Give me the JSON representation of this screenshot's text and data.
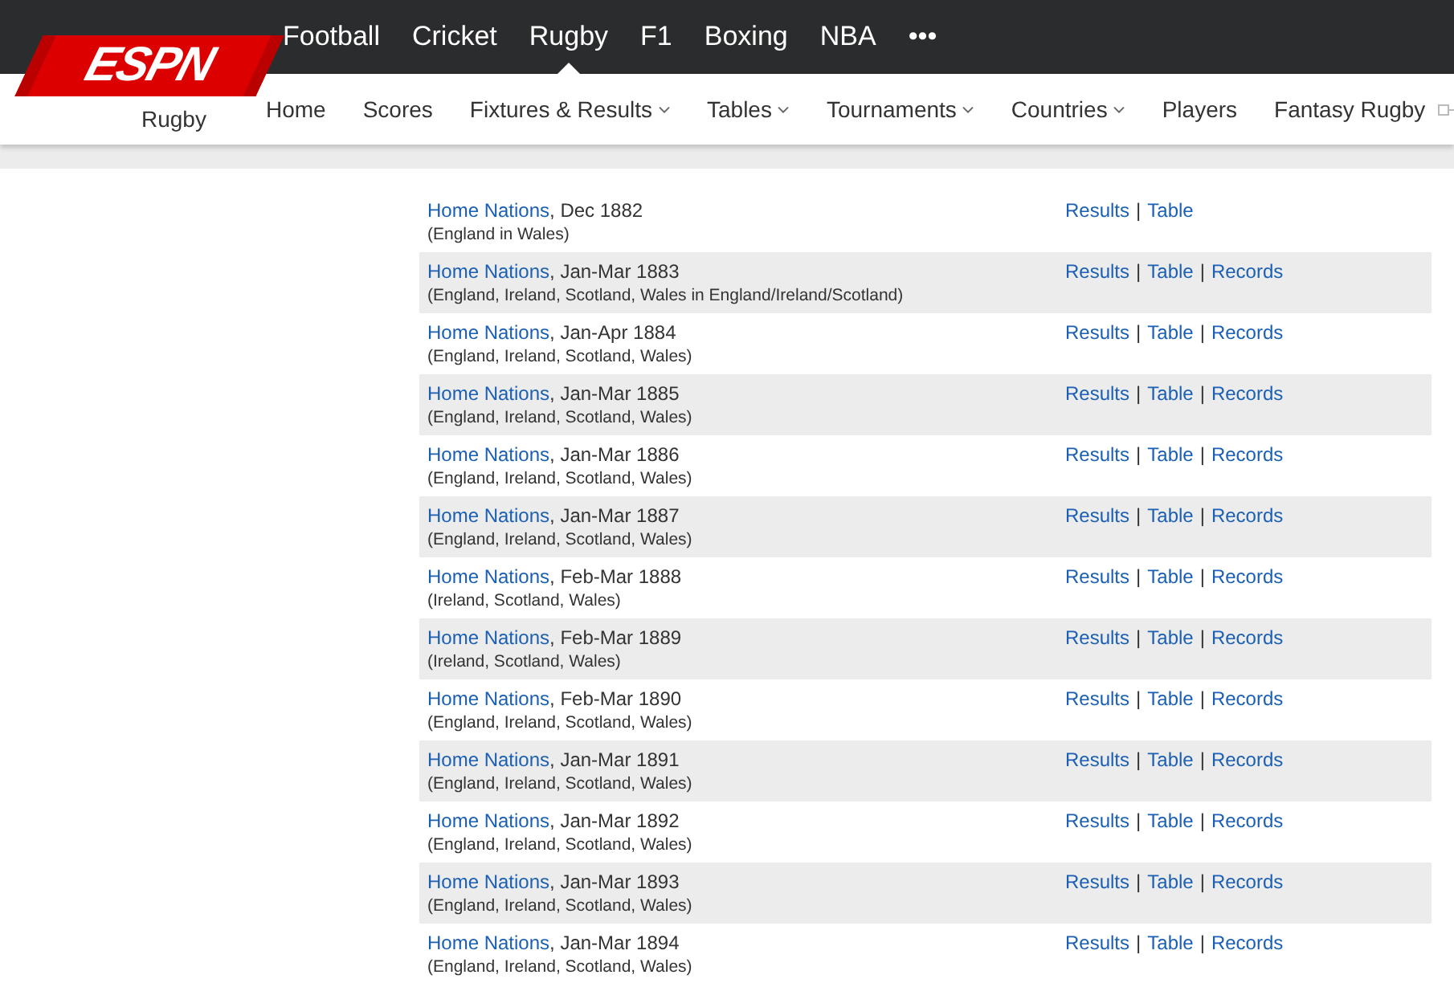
{
  "logo": {
    "text": "ESPN"
  },
  "top_nav": [
    {
      "label": "Football",
      "selected": false
    },
    {
      "label": "Cricket",
      "selected": false
    },
    {
      "label": "Rugby",
      "selected": true
    },
    {
      "label": "F1",
      "selected": false
    },
    {
      "label": "Boxing",
      "selected": false
    },
    {
      "label": "NBA",
      "selected": false
    },
    {
      "label": "•••",
      "selected": false
    }
  ],
  "section_title": "Rugby",
  "sub_nav": [
    {
      "label": "Home",
      "has_menu": false,
      "external": false
    },
    {
      "label": "Scores",
      "has_menu": false,
      "external": false
    },
    {
      "label": "Fixtures & Results",
      "has_menu": true,
      "external": false
    },
    {
      "label": "Tables",
      "has_menu": true,
      "external": false
    },
    {
      "label": "Tournaments",
      "has_menu": true,
      "external": false
    },
    {
      "label": "Countries",
      "has_menu": true,
      "external": false
    },
    {
      "label": "Players",
      "has_menu": false,
      "external": false
    },
    {
      "label": "Fantasy Rugby",
      "has_menu": false,
      "external": true
    }
  ],
  "rows": [
    {
      "name": "Home Nations",
      "date": ", Dec 1882",
      "note": "(England in Wales)",
      "links": [
        {
          "kind": "link",
          "label": "Results"
        },
        {
          "kind": "separator",
          "label": "|"
        },
        {
          "kind": "link",
          "label": "Table"
        }
      ]
    },
    {
      "name": "Home Nations",
      "date": ", Jan-Mar 1883",
      "note": "(England, Ireland, Scotland, Wales in England/Ireland/Scotland)",
      "links": [
        {
          "kind": "link",
          "label": "Results"
        },
        {
          "kind": "separator",
          "label": "|"
        },
        {
          "kind": "link",
          "label": "Table"
        },
        {
          "kind": "separator",
          "label": "|"
        },
        {
          "kind": "link",
          "label": "Records"
        }
      ]
    },
    {
      "name": "Home Nations",
      "date": ", Jan-Apr 1884",
      "note": "(England, Ireland, Scotland, Wales)",
      "links": [
        {
          "kind": "link",
          "label": "Results"
        },
        {
          "kind": "separator",
          "label": "|"
        },
        {
          "kind": "link",
          "label": "Table"
        },
        {
          "kind": "separator",
          "label": "|"
        },
        {
          "kind": "link",
          "label": "Records"
        }
      ]
    },
    {
      "name": "Home Nations",
      "date": ", Jan-Mar 1885",
      "note": "(England, Ireland, Scotland, Wales)",
      "links": [
        {
          "kind": "link",
          "label": "Results"
        },
        {
          "kind": "separator",
          "label": "|"
        },
        {
          "kind": "link",
          "label": "Table"
        },
        {
          "kind": "separator",
          "label": "|"
        },
        {
          "kind": "link",
          "label": "Records"
        }
      ]
    },
    {
      "name": "Home Nations",
      "date": ", Jan-Mar 1886",
      "note": "(England, Ireland, Scotland, Wales)",
      "links": [
        {
          "kind": "link",
          "label": "Results"
        },
        {
          "kind": "separator",
          "label": "|"
        },
        {
          "kind": "link",
          "label": "Table"
        },
        {
          "kind": "separator",
          "label": "|"
        },
        {
          "kind": "link",
          "label": "Records"
        }
      ]
    },
    {
      "name": "Home Nations",
      "date": ", Jan-Mar 1887",
      "note": "(England, Ireland, Scotland, Wales)",
      "links": [
        {
          "kind": "link",
          "label": "Results"
        },
        {
          "kind": "separator",
          "label": "|"
        },
        {
          "kind": "link",
          "label": "Table"
        },
        {
          "kind": "separator",
          "label": "|"
        },
        {
          "kind": "link",
          "label": "Records"
        }
      ]
    },
    {
      "name": "Home Nations",
      "date": ", Feb-Mar 1888",
      "note": "(Ireland, Scotland, Wales)",
      "links": [
        {
          "kind": "link",
          "label": "Results"
        },
        {
          "kind": "separator",
          "label": "|"
        },
        {
          "kind": "link",
          "label": "Table"
        },
        {
          "kind": "separator",
          "label": "|"
        },
        {
          "kind": "link",
          "label": "Records"
        }
      ]
    },
    {
      "name": "Home Nations",
      "date": ", Feb-Mar 1889",
      "note": "(Ireland, Scotland, Wales)",
      "links": [
        {
          "kind": "link",
          "label": "Results"
        },
        {
          "kind": "separator",
          "label": "|"
        },
        {
          "kind": "link",
          "label": "Table"
        },
        {
          "kind": "separator",
          "label": "|"
        },
        {
          "kind": "link",
          "label": "Records"
        }
      ]
    },
    {
      "name": "Home Nations",
      "date": ", Feb-Mar 1890",
      "note": "(England, Ireland, Scotland, Wales)",
      "links": [
        {
          "kind": "link",
          "label": "Results"
        },
        {
          "kind": "separator",
          "label": "|"
        },
        {
          "kind": "link",
          "label": "Table"
        },
        {
          "kind": "separator",
          "label": "|"
        },
        {
          "kind": "link",
          "label": "Records"
        }
      ]
    },
    {
      "name": "Home Nations",
      "date": ", Jan-Mar 1891",
      "note": "(England, Ireland, Scotland, Wales)",
      "links": [
        {
          "kind": "link",
          "label": "Results"
        },
        {
          "kind": "separator",
          "label": "|"
        },
        {
          "kind": "link",
          "label": "Table"
        },
        {
          "kind": "separator",
          "label": "|"
        },
        {
          "kind": "link",
          "label": "Records"
        }
      ]
    },
    {
      "name": "Home Nations",
      "date": ", Jan-Mar 1892",
      "note": "(England, Ireland, Scotland, Wales)",
      "links": [
        {
          "kind": "link",
          "label": "Results"
        },
        {
          "kind": "separator",
          "label": "|"
        },
        {
          "kind": "link",
          "label": "Table"
        },
        {
          "kind": "separator",
          "label": "|"
        },
        {
          "kind": "link",
          "label": "Records"
        }
      ]
    },
    {
      "name": "Home Nations",
      "date": ", Jan-Mar 1893",
      "note": "(England, Ireland, Scotland, Wales)",
      "links": [
        {
          "kind": "link",
          "label": "Results"
        },
        {
          "kind": "separator",
          "label": "|"
        },
        {
          "kind": "link",
          "label": "Table"
        },
        {
          "kind": "separator",
          "label": "|"
        },
        {
          "kind": "link",
          "label": "Records"
        }
      ]
    },
    {
      "name": "Home Nations",
      "date": ", Jan-Mar 1894",
      "note": "(England, Ireland, Scotland, Wales)",
      "links": [
        {
          "kind": "link",
          "label": "Results"
        },
        {
          "kind": "separator",
          "label": "|"
        },
        {
          "kind": "link",
          "label": "Table"
        },
        {
          "kind": "separator",
          "label": "|"
        },
        {
          "kind": "link",
          "label": "Records"
        }
      ]
    }
  ]
}
